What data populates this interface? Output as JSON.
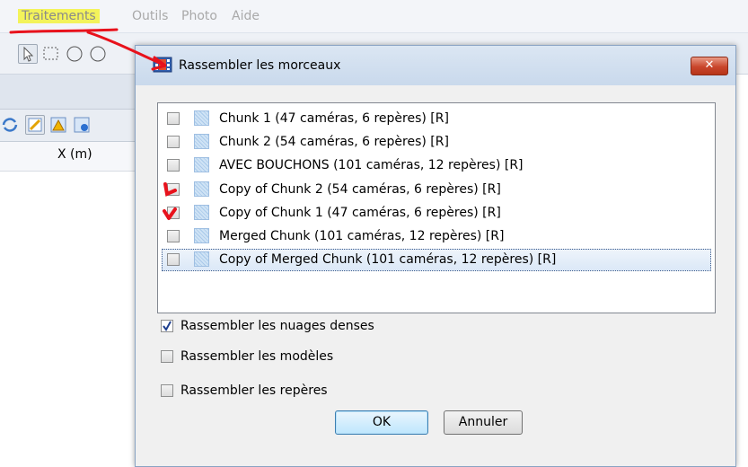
{
  "menu": {
    "items": [
      "Traitements",
      "Outils",
      "Photo",
      "Aide"
    ]
  },
  "panel": {
    "column_header": "X (m)"
  },
  "dialog": {
    "title": "Rassembler les morceaux",
    "close_glyph": "✕",
    "chunks": [
      {
        "label": "Chunk 1 (47 caméras, 6 repères) [R]",
        "checked": false,
        "marked": false
      },
      {
        "label": "Chunk 2 (54 caméras, 6 repères) [R]",
        "checked": false,
        "marked": false
      },
      {
        "label": "AVEC BOUCHONS (101 caméras, 12 repères) [R]",
        "checked": false,
        "marked": false
      },
      {
        "label": "Copy of Chunk 2 (54 caméras, 6 repères) [R]",
        "checked": false,
        "marked": true
      },
      {
        "label": "Copy of Chunk 1 (47 caméras, 6 repères) [R]",
        "checked": false,
        "marked": true
      },
      {
        "label": "Merged Chunk (101 caméras, 12 repères) [R]",
        "checked": false,
        "marked": false
      },
      {
        "label": "Copy of Merged Chunk (101 caméras, 12 repères) [R]",
        "checked": false,
        "marked": false,
        "selected": true
      }
    ],
    "options": [
      {
        "label": "Rassembler les nuages denses",
        "checked": true
      },
      {
        "label": "Rassembler les modèles",
        "checked": false
      },
      {
        "label": "Rassembler les repères",
        "checked": false
      }
    ],
    "ok_label": "OK",
    "cancel_label": "Annuler"
  },
  "colors": {
    "highlight": "#f3f35a",
    "annotation_red": "#e8121c"
  }
}
